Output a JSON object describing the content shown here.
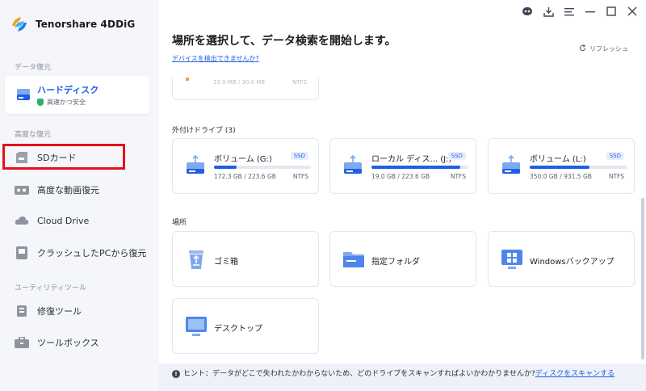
{
  "app": {
    "name": "Tenorshare 4DDiG"
  },
  "sidebar": {
    "sections": {
      "recovery": "データ復元",
      "advanced": "高度な復元",
      "utility": "ユーティリティツール"
    },
    "active": {
      "title": "ハードディスク",
      "subtitle": "高速かつ安全"
    },
    "items": [
      {
        "label": "SDカード"
      },
      {
        "label": "高度な動画復元"
      },
      {
        "label": "Cloud Drive"
      },
      {
        "label": "クラッシュしたPCから復元"
      },
      {
        "label": "修復ツール"
      },
      {
        "label": "ツールボックス"
      }
    ]
  },
  "main": {
    "title": "場所を選択して、データ検索を開始します。",
    "detect_link": "デバイスを検出できませんか?",
    "refresh": "リフレッシュ",
    "partial_card": {
      "usage": "19.0 MB / 30.0 MB",
      "fs": "NTFS"
    },
    "external_label": "外付けドライブ (3)",
    "drives": [
      {
        "name": "ボリューム (G:)",
        "badge": "SSD",
        "usage": "172.3 GB / 223.6 GB",
        "fs": "NTFS",
        "fill": 0.23
      },
      {
        "name": "ローカル ディス... (J:)",
        "badge": "SSD",
        "usage": "19.0 GB / 223.6 GB",
        "fs": "NTFS",
        "fill": 0.92
      },
      {
        "name": "ボリューム (L:)",
        "badge": "SSD",
        "usage": "350.0 GB / 931.5 GB",
        "fs": "NTFS",
        "fill": 0.62
      }
    ],
    "locations_label": "場所",
    "locations": [
      {
        "name": "ゴミ箱"
      },
      {
        "name": "指定フォルダ"
      },
      {
        "name": "Windowsバックアップ"
      },
      {
        "name": "デスクトップ"
      }
    ]
  },
  "hint": {
    "text": "ヒント：データがどこで失われたかわからないため、どのドライブをスキャンすればよいかわかりませんか?",
    "link": "ディスクをスキャンする"
  },
  "colors": {
    "accent": "#1d5fe8",
    "highlight": "#e5101d"
  }
}
